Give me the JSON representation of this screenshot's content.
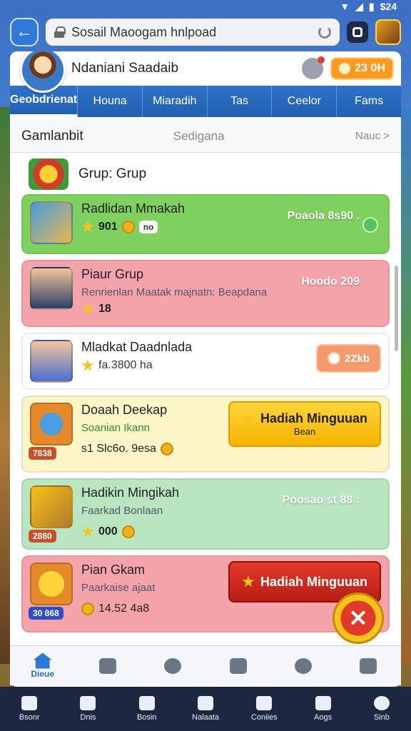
{
  "status": {
    "time": "$24"
  },
  "url_bar": {
    "text": "Sosail Maoogam hnlpoad"
  },
  "profile": {
    "name": "Ndaniani Saadaib",
    "coins": "23 0H"
  },
  "nav_tabs": [
    "Geobdrienat",
    "Houna",
    "Miaradih",
    "Tas",
    "Ceelor",
    "Fams"
  ],
  "section": {
    "title": "Gamlanbit",
    "subtitle": "Sedigana",
    "more": "Nauc >"
  },
  "group": {
    "title": "Grup: Grup"
  },
  "cards": [
    {
      "title": "Radlidan Mmakah",
      "meta_value": "901",
      "meta_tag": "no",
      "right_note": "Poaola 8s90 .",
      "color": "#7fd15f"
    },
    {
      "title": "Piaur Grup",
      "sub": "Renrienlan Maatak majnatn: Beapdana",
      "meta_value": "18",
      "right_note": "Hoodo 209",
      "color": "#f5a3ab"
    },
    {
      "title": "Mladkat Daadnlada",
      "meta_value": "fa.3800 ha",
      "button": "2Zkb",
      "color": "#ffffff"
    },
    {
      "title": "Doaah Deekap",
      "sub": "Soanian Ikann",
      "meta_value": "s1 Slc6o. 9esa",
      "badge": "7838",
      "button": "Hadiah Minguuan",
      "button_sub": "Bean",
      "color": "#fbf5c8"
    },
    {
      "title": "Hadikin Mingikah",
      "sub": "Faarkad Bonlaan",
      "meta_value": "000",
      "badge": "2880",
      "right_note": "Poosao st 88 :",
      "color": "#b9e6c0"
    },
    {
      "title": "Pian Gkam",
      "sub": "Paarkaise ajaat",
      "meta_value": "14.52 4a8",
      "badge": "30 868",
      "button": "Hadiah Minguuan",
      "color": "#f5a3ab"
    }
  ],
  "inner_tabs": [
    {
      "label": "Dieue"
    },
    {
      "label": ""
    },
    {
      "label": ""
    },
    {
      "label": ""
    },
    {
      "label": ""
    },
    {
      "label": ""
    }
  ],
  "bottom_nav": [
    "Bsonr",
    "Dnis",
    "Bosin",
    "Nalaata",
    "Coniies",
    "Aogs",
    "Sinb"
  ]
}
